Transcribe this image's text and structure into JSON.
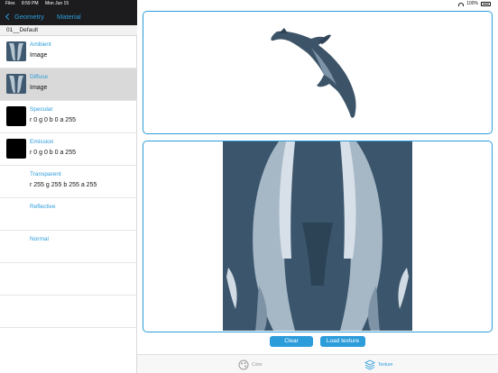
{
  "status": {
    "carrier": "Files",
    "time": "8:59 PM",
    "date": "Mon Jun 15",
    "battery": "100%"
  },
  "nav": {
    "back_label": "Geometry",
    "title": "Material"
  },
  "section": {
    "title": "01__Default"
  },
  "properties": [
    {
      "name": "Ambient",
      "value": "Image"
    },
    {
      "name": "Diffuse",
      "value": "Image"
    },
    {
      "name": "Specular",
      "value": "r 0 g 0 b 0 a 255"
    },
    {
      "name": "Emission",
      "value": "r 0 g 0 b 0 a 255"
    },
    {
      "name": "Transparent",
      "value": "r 255 g 255 b 255 a 255"
    },
    {
      "name": "Reflective",
      "value": ""
    },
    {
      "name": "Normal",
      "value": ""
    }
  ],
  "buttons": {
    "clear": "Clear",
    "load_texture": "Load texture"
  },
  "tabs": {
    "color": "Color",
    "texture": "Texture"
  },
  "colors": {
    "accent": "#2d9cdb",
    "selected_row": "#d9d9d9",
    "nav_bg": "#1c1c1e",
    "texture_bg": "#3a556c"
  }
}
